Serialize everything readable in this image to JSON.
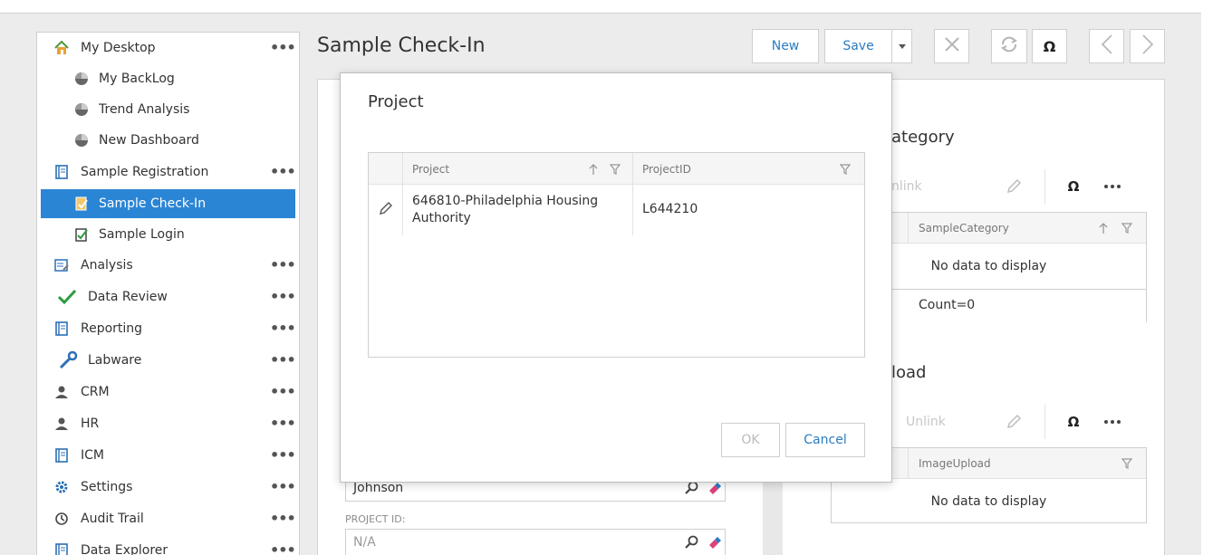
{
  "sidebar": {
    "items": [
      {
        "label": "My Desktop",
        "icon": "home-icon",
        "more": "•••"
      },
      {
        "label": "My BackLog",
        "icon": "pie-chart-icon"
      },
      {
        "label": "Trend Analysis",
        "icon": "pie-chart-icon"
      },
      {
        "label": "New Dashboard",
        "icon": "pie-chart-icon"
      },
      {
        "label": "Sample Registration",
        "icon": "book-icon",
        "more": "•••"
      },
      {
        "label": "Sample Check-In",
        "icon": "checkin-icon"
      },
      {
        "label": "Sample Login",
        "icon": "clipboard-check-icon"
      },
      {
        "label": "Analysis",
        "icon": "edit-list-icon",
        "more": "•••"
      },
      {
        "label": "Data Review",
        "icon": "checkmark-icon",
        "more": "•••"
      },
      {
        "label": "Reporting",
        "icon": "book-icon",
        "more": "•••"
      },
      {
        "label": "Labware",
        "icon": "wrench-icon",
        "more": "•••"
      },
      {
        "label": "CRM",
        "icon": "person-icon",
        "more": "•••"
      },
      {
        "label": "HR",
        "icon": "person-icon",
        "more": "•••"
      },
      {
        "label": "ICM",
        "icon": "book-icon",
        "more": "•••"
      },
      {
        "label": "Settings",
        "icon": "gear-icon",
        "more": "•••"
      },
      {
        "label": "Audit Trail",
        "icon": "history-icon",
        "more": "•••"
      },
      {
        "label": "Data Explorer",
        "icon": "book-icon",
        "more": "•••"
      }
    ]
  },
  "page": {
    "title": "Sample Check-In"
  },
  "toolbar": {
    "new_label": "New",
    "save_label": "Save",
    "omega": "Ω"
  },
  "right_panel": {
    "category_title": "ategory",
    "unlink_label_1": "nlink",
    "category_col": "SampleCategory",
    "no_data_1": "No data to display",
    "count_text": "Count=0",
    "upload_title": "load",
    "unlink_label_2": "Unlink",
    "upload_col": "ImageUpload",
    "no_data_2": "No data to display",
    "omega": "Ω"
  },
  "form": {
    "contact_value": "Johnson",
    "project_id_label": "PROJECT ID:",
    "project_id_value": "N/A"
  },
  "modal": {
    "title": "Project",
    "columns": {
      "project": "Project",
      "project_id": "ProjectID"
    },
    "rows": [
      {
        "project_line1": "646810-Philadelphia Housing",
        "project_line2": "Authority",
        "project_id": "L644210"
      }
    ],
    "ok_label": "OK",
    "cancel_label": "Cancel"
  },
  "colors": {
    "accent": "#2b85d5",
    "link": "#2b7cc0",
    "eraser": "#e0407a"
  }
}
